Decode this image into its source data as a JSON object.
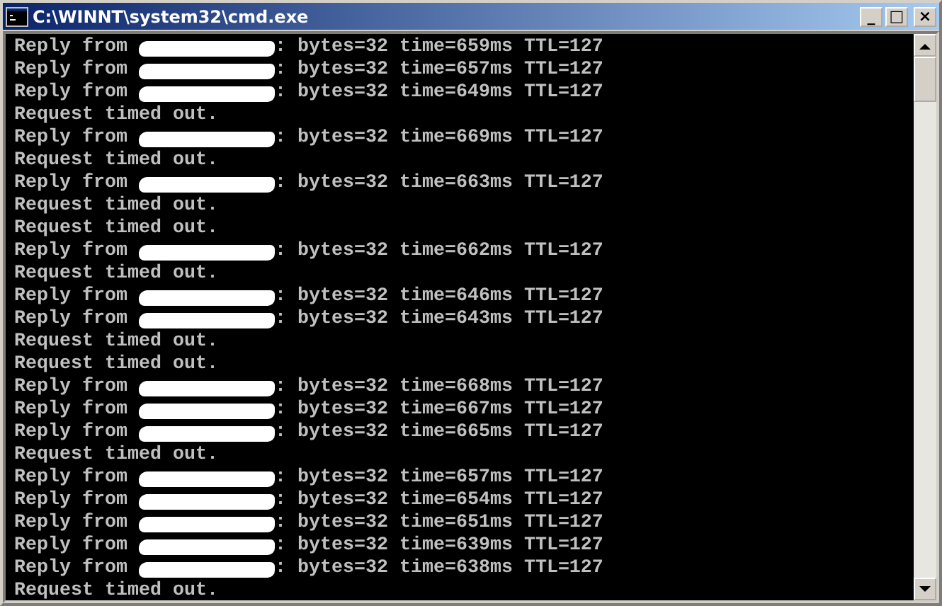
{
  "window": {
    "title": "C:\\WINNT\\system32\\cmd.exe",
    "buttons": [
      "_",
      "□",
      "×"
    ]
  },
  "lines": [
    {
      "kind": "reply",
      "prefix": "Reply from",
      "suffix": ": bytes=32 time=659ms TTL=127"
    },
    {
      "kind": "reply",
      "prefix": "Reply from",
      "suffix": ": bytes=32 time=657ms TTL=127"
    },
    {
      "kind": "reply",
      "prefix": "Reply from",
      "suffix": ": bytes=32 time=649ms TTL=127"
    },
    {
      "kind": "timeout",
      "text": "Request timed out."
    },
    {
      "kind": "reply",
      "prefix": "Reply from",
      "suffix": ": bytes=32 time=669ms TTL=127"
    },
    {
      "kind": "timeout",
      "text": "Request timed out."
    },
    {
      "kind": "reply",
      "prefix": "Reply from",
      "suffix": ": bytes=32 time=663ms TTL=127"
    },
    {
      "kind": "timeout",
      "text": "Request timed out."
    },
    {
      "kind": "timeout",
      "text": "Request timed out."
    },
    {
      "kind": "reply",
      "prefix": "Reply from",
      "suffix": ": bytes=32 time=662ms TTL=127"
    },
    {
      "kind": "timeout",
      "text": "Request timed out."
    },
    {
      "kind": "reply",
      "prefix": "Reply from",
      "suffix": ": bytes=32 time=646ms TTL=127"
    },
    {
      "kind": "reply",
      "prefix": "Reply from",
      "suffix": ": bytes=32 time=643ms TTL=127"
    },
    {
      "kind": "timeout",
      "text": "Request timed out."
    },
    {
      "kind": "timeout",
      "text": "Request timed out."
    },
    {
      "kind": "reply",
      "prefix": "Reply from",
      "suffix": ": bytes=32 time=668ms TTL=127"
    },
    {
      "kind": "reply",
      "prefix": "Reply from",
      "suffix": ": bytes=32 time=667ms TTL=127"
    },
    {
      "kind": "reply",
      "prefix": "Reply from",
      "suffix": ": bytes=32 time=665ms TTL=127"
    },
    {
      "kind": "timeout",
      "text": "Request timed out."
    },
    {
      "kind": "reply",
      "prefix": "Reply from",
      "suffix": ": bytes=32 time=657ms TTL=127"
    },
    {
      "kind": "reply",
      "prefix": "Reply from",
      "suffix": ": bytes=32 time=654ms TTL=127"
    },
    {
      "kind": "reply",
      "prefix": "Reply from",
      "suffix": ": bytes=32 time=651ms TTL=127"
    },
    {
      "kind": "reply",
      "prefix": "Reply from",
      "suffix": ": bytes=32 time=639ms TTL=127"
    },
    {
      "kind": "reply",
      "prefix": "Reply from",
      "suffix": ": bytes=32 time=638ms TTL=127"
    },
    {
      "kind": "timeout",
      "text": "Request timed out."
    }
  ]
}
